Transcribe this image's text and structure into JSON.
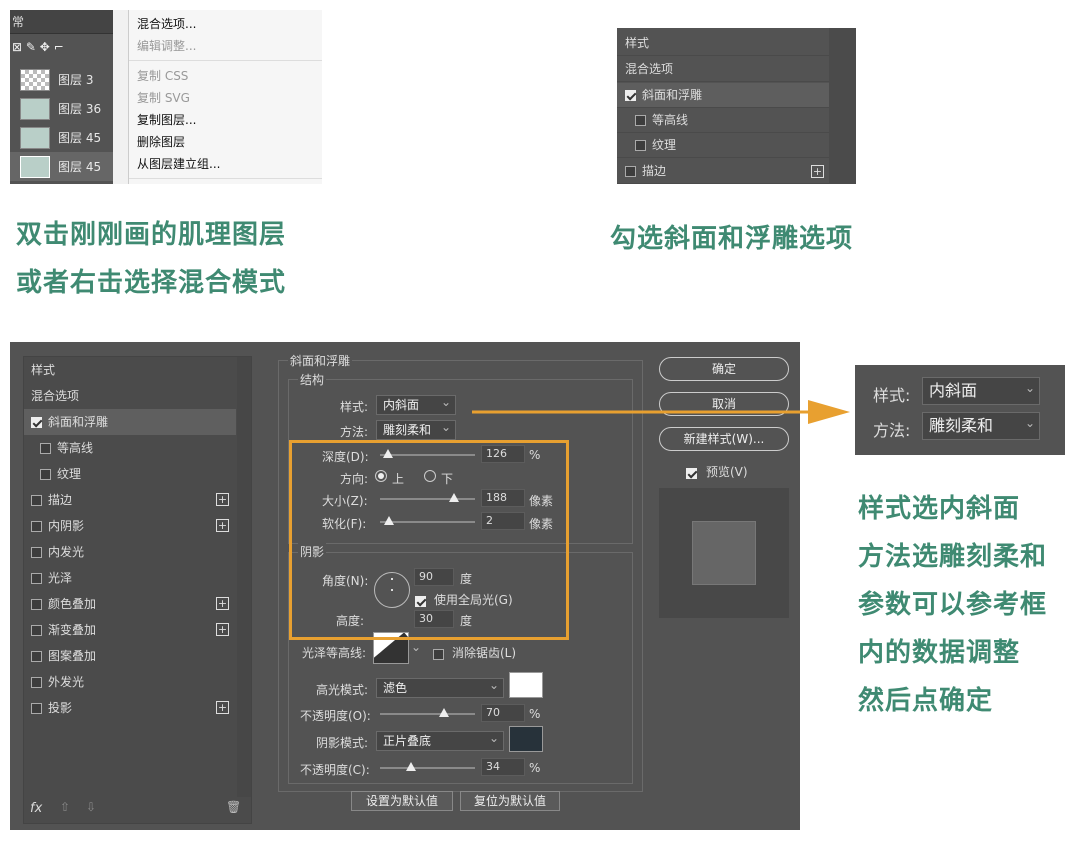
{
  "top_left": {
    "top_dropdown": "常",
    "tools": "⊠ ✎ ✥ ⌐",
    "layers": [
      "图层 3",
      "图层 36",
      "图层 45",
      "图层 45"
    ],
    "menu": [
      {
        "label": "混合选项...",
        "enabled": true
      },
      {
        "label": "编辑调整...",
        "enabled": false
      },
      {
        "label": "复制 CSS",
        "enabled": false
      },
      {
        "label": "复制 SVG",
        "enabled": false
      },
      {
        "label": "复制图层...",
        "enabled": true
      },
      {
        "label": "删除图层",
        "enabled": true
      },
      {
        "label": "从图层建立组...",
        "enabled": true
      }
    ]
  },
  "top_right": {
    "rows": [
      "样式",
      "混合选项",
      "斜面和浮雕",
      "等高线",
      "纹理",
      "描边"
    ]
  },
  "captions": {
    "c1_line1": "双击刚刚画的肌理图层",
    "c1_line2": "或者右击选择混合模式",
    "c2": "勾选斜面和浮雕选项",
    "c3_lines": [
      "样式选内斜面",
      "方法选雕刻柔和",
      "参数可以参考框",
      "内的数据调整",
      "然后点确定"
    ]
  },
  "dialog": {
    "left_list": [
      {
        "label": "样式"
      },
      {
        "label": "混合选项"
      },
      {
        "label": "斜面和浮雕",
        "checked": true
      },
      {
        "label": "等高线"
      },
      {
        "label": "纹理"
      },
      {
        "label": "描边"
      },
      {
        "label": "内阴影"
      },
      {
        "label": "内发光"
      },
      {
        "label": "光泽"
      },
      {
        "label": "颜色叠加"
      },
      {
        "label": "渐变叠加"
      },
      {
        "label": "图案叠加"
      },
      {
        "label": "外发光"
      },
      {
        "label": "投影"
      }
    ],
    "bottom_icons": {
      "fx": "fx",
      "up": "⇧",
      "down": "⇩",
      "trash": "🗑"
    },
    "bevel_title": "斜面和浮雕",
    "structure_title": "结构",
    "style_label": "样式:",
    "style_value": "内斜面",
    "method_label": "方法:",
    "method_value": "雕刻柔和",
    "depth_label": "深度(D):",
    "depth_value": "126",
    "depth_unit": "%",
    "direction_label": "方向:",
    "dir_up": "上",
    "dir_down": "下",
    "size_label": "大小(Z):",
    "size_value": "188",
    "size_unit": "像素",
    "soften_label": "软化(F):",
    "soften_value": "2",
    "soften_unit": "像素",
    "shading_title": "阴影",
    "angle_label": "角度(N):",
    "angle_value": "90",
    "angle_unit": "度",
    "global_light": "使用全局光(G)",
    "altitude_label": "高度:",
    "altitude_value": "30",
    "altitude_unit": "度",
    "gloss_label": "光泽等高线:",
    "antialias": "消除锯齿(L)",
    "highlight_label": "高光模式:",
    "highlight_value": "滤色",
    "hl_opacity_label": "不透明度(O):",
    "hl_opacity_value": "70",
    "hl_opacity_unit": "%",
    "shadow_label": "阴影模式:",
    "shadow_value": "正片叠底",
    "sh_opacity_label": "不透明度(C):",
    "sh_opacity_value": "34",
    "sh_opacity_unit": "%",
    "make_default": "设置为默认值",
    "reset_default": "复位为默认值",
    "ok": "确定",
    "cancel": "取消",
    "new_style": "新建样式(W)...",
    "preview": "预览(V)",
    "highlight_color": "#ffffff",
    "shadow_color": "#27323a"
  },
  "zoom": {
    "style_label": "样式:",
    "style_value": "内斜面",
    "method_label": "方法:",
    "method_value": "雕刻柔和"
  },
  "colors": {
    "caption": "#3f8a72",
    "highlight_box": "#e8a030",
    "panel": "#535353"
  }
}
